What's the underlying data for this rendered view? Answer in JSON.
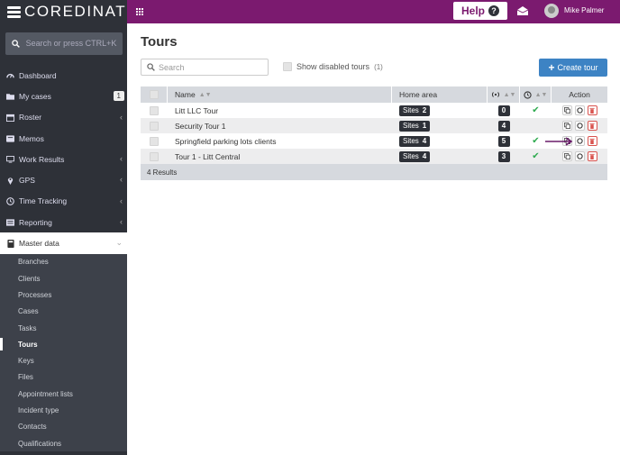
{
  "brand": {
    "name": "COREDINATE"
  },
  "topbar": {
    "help_label": "Help",
    "help_symbol": "?",
    "user_name": "Mike Palmer"
  },
  "sidebar": {
    "search_placeholder": "Search or press CTRL+K",
    "items": [
      {
        "label": "Dashboard",
        "icon": "dashboard-icon"
      },
      {
        "label": "My cases",
        "icon": "folder-icon",
        "badge": "1"
      },
      {
        "label": "Roster",
        "icon": "calendar-icon",
        "chevron": "‹"
      },
      {
        "label": "Memos",
        "icon": "memo-icon"
      },
      {
        "label": "Work Results",
        "icon": "monitor-icon",
        "chevron": "‹"
      },
      {
        "label": "GPS",
        "icon": "map-marker-icon",
        "chevron": "‹"
      },
      {
        "label": "Time Tracking",
        "icon": "clock-icon",
        "chevron": "‹"
      },
      {
        "label": "Reporting",
        "icon": "report-icon",
        "chevron": "‹"
      },
      {
        "label": "Master data",
        "icon": "book-icon",
        "chevron": "⌄",
        "active": true
      }
    ],
    "sub_items": [
      {
        "label": "Branches"
      },
      {
        "label": "Clients"
      },
      {
        "label": "Processes"
      },
      {
        "label": "Cases"
      },
      {
        "label": "Tasks"
      },
      {
        "label": "Tours",
        "active": true
      },
      {
        "label": "Keys"
      },
      {
        "label": "Files"
      },
      {
        "label": "Appointment lists"
      },
      {
        "label": "Incident type"
      },
      {
        "label": "Contacts"
      },
      {
        "label": "Qualifications"
      }
    ]
  },
  "main": {
    "title": "Tours",
    "search_placeholder": "Search",
    "show_disabled_label": "Show disabled tours",
    "show_disabled_count": "(1)",
    "create_label": "Create tour",
    "columns": {
      "name": "Name",
      "home_area": "Home area",
      "action": "Action"
    },
    "rows": [
      {
        "name": "Litt LLC Tour",
        "sites_label": "Sites",
        "sites_count": "2",
        "count": "0",
        "status": true
      },
      {
        "name": "Security Tour 1",
        "sites_label": "Sites",
        "sites_count": "1",
        "count": "4",
        "status": false
      },
      {
        "name": "Springfield parking lots clients",
        "sites_label": "Sites",
        "sites_count": "4",
        "count": "5",
        "status": true
      },
      {
        "name": "Tour 1 - Litt Central",
        "sites_label": "Sites",
        "sites_count": "4",
        "count": "3",
        "status": true
      }
    ],
    "footer": "4 Results"
  },
  "colors": {
    "brand_bar": "#2e3138",
    "top_nav": "#7b1a6f",
    "primary": "#3d83c4",
    "success": "#2eaa4f",
    "danger": "#d9534f"
  }
}
